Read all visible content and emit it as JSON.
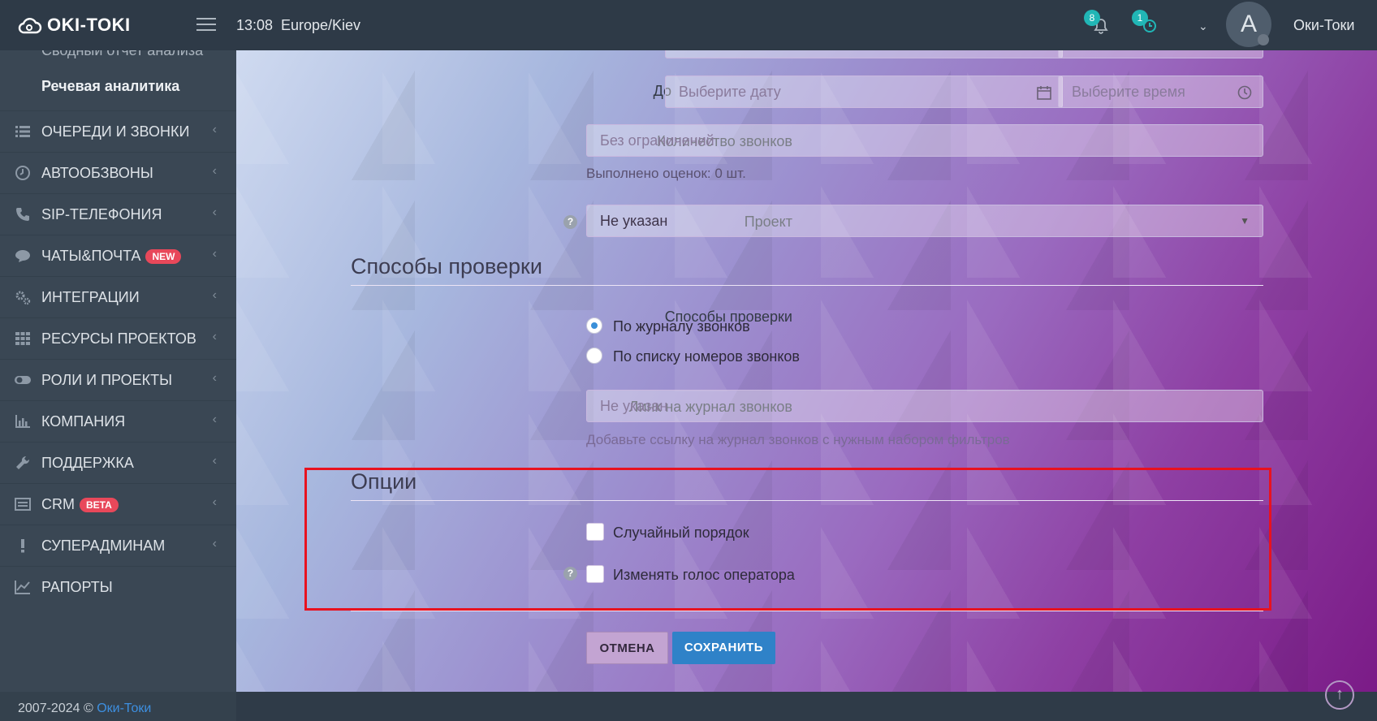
{
  "topbar": {
    "logo_text": "OKI-TOKI",
    "time": "13:08",
    "timezone": "Europe/Kiev",
    "notifications_count": "8",
    "tasks_count": "1",
    "avatar_letter": "A",
    "user_name": "Оки-Токи"
  },
  "sidebar": {
    "sub_items": [
      "Сводный отчет анализа",
      "Речевая аналитика"
    ],
    "items": [
      {
        "label": "ОЧЕРЕДИ И ЗВОНКИ",
        "icon": "list-icon",
        "badge": ""
      },
      {
        "label": "АВТООБЗВОНЫ",
        "icon": "clock-icon",
        "badge": ""
      },
      {
        "label": "SIP-ТЕЛЕФОНИЯ",
        "icon": "phone-icon",
        "badge": ""
      },
      {
        "label": "ЧАТЫ&ПОЧТА",
        "icon": "chat-icon",
        "badge": "NEW"
      },
      {
        "label": "ИНТЕГРАЦИИ",
        "icon": "gears-icon",
        "badge": ""
      },
      {
        "label": "РЕСУРСЫ ПРОЕКТОВ",
        "icon": "grid-icon",
        "badge": ""
      },
      {
        "label": "РОЛИ И ПРОЕКТЫ",
        "icon": "toggle-icon",
        "badge": ""
      },
      {
        "label": "КОМПАНИЯ",
        "icon": "bar-chart-icon",
        "badge": ""
      },
      {
        "label": "ПОДДЕРЖКА",
        "icon": "wrench-icon",
        "badge": ""
      },
      {
        "label": "CRM",
        "icon": "crm-icon",
        "badge": "BETA"
      },
      {
        "label": "СУПЕРАДМИНАМ",
        "icon": "exclamation-icon",
        "badge": ""
      },
      {
        "label": "РАПОРТЫ",
        "icon": "line-chart-icon",
        "badge": ""
      }
    ],
    "footer_text": "2007-2024 ©",
    "footer_link": "Оки-Токи"
  },
  "form": {
    "to_label": "До",
    "date_placeholder": "Выберите дату",
    "time_placeholder": "Выберите время",
    "calls_count_label": "Количество звонков",
    "calls_count_placeholder": "Без ограничений",
    "evaluations_done": "Выполнено оценок: 0 шт.",
    "project_label": "Проект",
    "project_value": "Не указан",
    "verification_section": "Способы проверки",
    "verification_label": "Способы проверки",
    "verification_options": [
      "По журналу звонков",
      "По списку номеров звонков"
    ],
    "verification_selected": "По журналу звонков",
    "link_label": "Линк на журнал звонков",
    "link_placeholder": "Не указан",
    "link_hint": "Добавьте ссылку на журнал звонков с нужным набором фильтров",
    "options_section": "Опции",
    "random_order_label": "Случайный порядок",
    "change_voice_label": "Изменять голос оператора",
    "cancel_label": "ОТМЕНА",
    "save_label": "СОХРАНИТЬ"
  },
  "colors": {
    "highlight": "#e8121f",
    "save_button": "#2f82c8",
    "badge_new": "#e8485a",
    "notification_badge": "#21b6b6"
  }
}
